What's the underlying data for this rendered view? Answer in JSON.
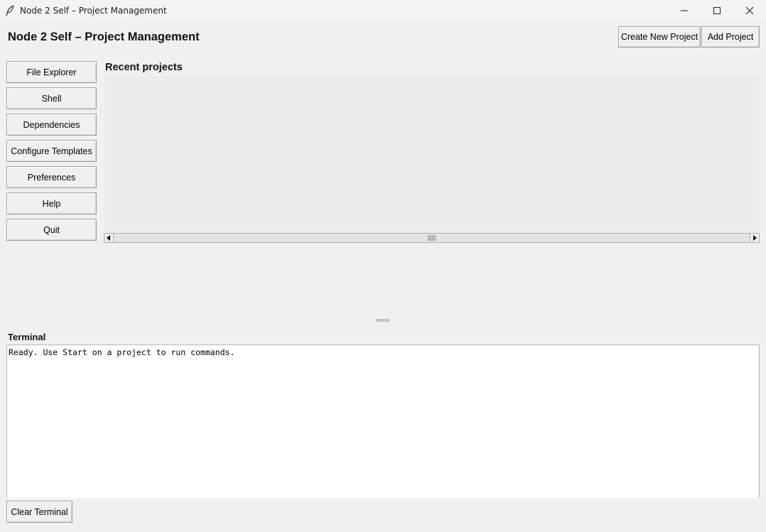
{
  "window": {
    "title": "Node 2 Self – Project Management",
    "icon": "feather-icon",
    "controls": {
      "minimize": "minimize-icon",
      "maximize": "maximize-icon",
      "close": "close-icon"
    }
  },
  "header": {
    "title": "Node 2 Self – Project Management",
    "create_label": "Create New Project",
    "add_label": "Add Project"
  },
  "sidebar": {
    "items": [
      {
        "label": "File Explorer"
      },
      {
        "label": "Shell"
      },
      {
        "label": "Dependencies"
      },
      {
        "label": "Configure Templates"
      },
      {
        "label": "Preferences"
      },
      {
        "label": "Help"
      },
      {
        "label": "Quit"
      }
    ]
  },
  "recent": {
    "label": "Recent projects",
    "items": []
  },
  "terminal": {
    "label": "Terminal",
    "output": "Ready. Use Start on a project to run commands.",
    "clear_label": "Clear Terminal"
  }
}
